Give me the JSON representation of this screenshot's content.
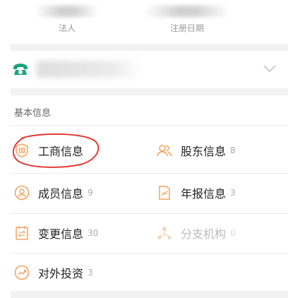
{
  "header": {
    "legal_person_label": "法人",
    "register_date_label": "注册日期"
  },
  "contact": {
    "phone_icon": "phone-icon",
    "expand_icon": "chevron-down-icon"
  },
  "section": {
    "title": "基本信息"
  },
  "items": [
    {
      "label": "工商信息",
      "count": "",
      "icon": "business-icon",
      "color": "#f5a05a"
    },
    {
      "label": "股东信息",
      "count": "8",
      "icon": "shareholders-icon",
      "color": "#f5a05a"
    },
    {
      "label": "成员信息",
      "count": "9",
      "icon": "member-icon",
      "color": "#f5a05a"
    },
    {
      "label": "年报信息",
      "count": "3",
      "icon": "annual-report-icon",
      "color": "#f5a05a"
    },
    {
      "label": "变更信息",
      "count": "30",
      "icon": "change-icon",
      "color": "#f5a05a"
    },
    {
      "label": "分支机构",
      "count": "0",
      "icon": "branch-icon",
      "color": "#f8d3b3"
    },
    {
      "label": "对外投资",
      "count": "3",
      "icon": "investment-icon",
      "color": "#f5a05a"
    }
  ],
  "colors": {
    "accent": "#f5a05a",
    "phone": "#1aa37a",
    "highlight_circle": "#e53935"
  }
}
